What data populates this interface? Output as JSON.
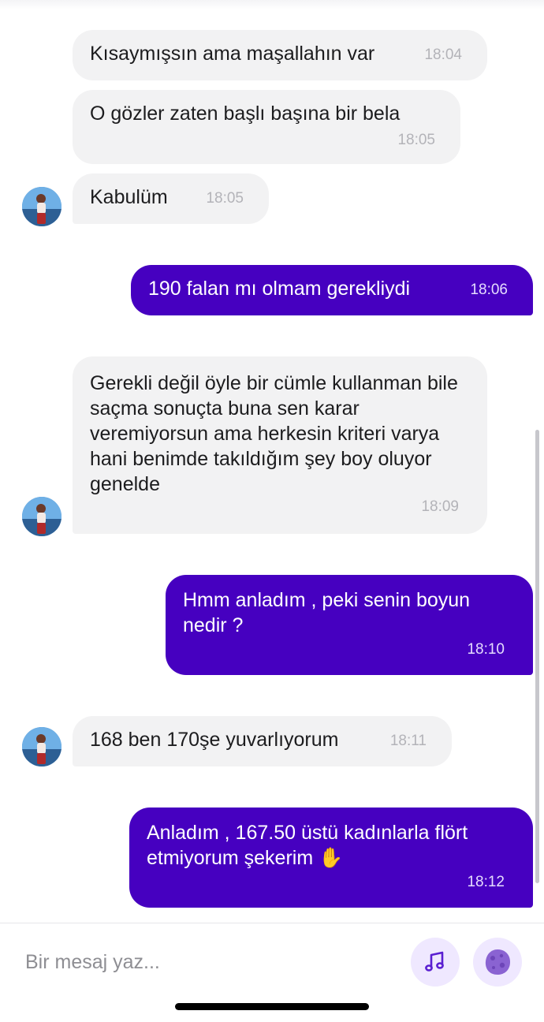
{
  "messages": [
    {
      "direction": "in",
      "text": "Kısaymışsın ama maşallahın var",
      "time": "18:04"
    },
    {
      "direction": "in",
      "text": "O gözler zaten başlı başına bir bela",
      "time": "18:05"
    },
    {
      "direction": "in",
      "text": "Kabulüm",
      "time": "18:05",
      "avatar": true
    },
    {
      "direction": "out",
      "text": "190 falan mı olmam gerekliydi",
      "time": "18:06"
    },
    {
      "direction": "in",
      "text": "Gerekli değil öyle bir cümle kullanman bile saçma sonuçta buna sen karar veremiyorsun ama herkesin kriteri varya hani benimde takıldığım şey boy oluyor genelde",
      "time": "18:09",
      "avatar": true
    },
    {
      "direction": "out",
      "text": "Hmm anladım , peki senin boyun nedir ?",
      "time": "18:10"
    },
    {
      "direction": "in",
      "text": "168 ben 170şe yuvarlıyorum",
      "time": "18:11",
      "avatar": true
    },
    {
      "direction": "out",
      "text": "Anladım , 167.50 üstü kadınlarla flört etmiyorum şekerim ✋",
      "time": "18:12"
    }
  ],
  "composer": {
    "placeholder": "Bir mesaj yaz..."
  },
  "icons": {
    "music": "music-note-icon",
    "sticker": "planet-sticker-icon"
  },
  "colors": {
    "outgoing_bubble": "#4600c0",
    "incoming_bubble": "#f2f2f3",
    "accent": "#5a1fd1"
  }
}
